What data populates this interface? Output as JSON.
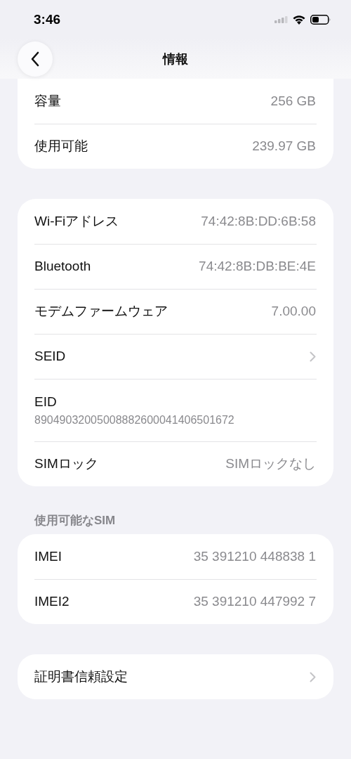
{
  "status_bar": {
    "time": "3:46"
  },
  "nav": {
    "title": "情報"
  },
  "groups": [
    {
      "continued": true,
      "rows": [
        {
          "kind": "value",
          "label": "容量",
          "value": "256 GB"
        },
        {
          "kind": "value",
          "label": "使用可能",
          "value": "239.97 GB"
        }
      ]
    },
    {
      "continued": false,
      "rows": [
        {
          "kind": "value",
          "label": "Wi-Fiアドレス",
          "value": "74:42:8B:DD:6B:58"
        },
        {
          "kind": "value",
          "label": "Bluetooth",
          "value": "74:42:8B:DB:BE:4E"
        },
        {
          "kind": "value",
          "label": "モデムファームウェア",
          "value": "7.00.00"
        },
        {
          "kind": "link",
          "label": "SEID"
        },
        {
          "kind": "stacked",
          "label": "EID",
          "value": "89049032005008882600041406501672"
        },
        {
          "kind": "value",
          "label": "SIMロック",
          "value": "SIMロックなし"
        }
      ]
    },
    {
      "continued": false,
      "header": "使用可能なSIM",
      "rows": [
        {
          "kind": "value",
          "label": "IMEI",
          "value": "35 391210 448838 1"
        },
        {
          "kind": "value",
          "label": "IMEI2",
          "value": "35 391210 447992 7"
        }
      ]
    },
    {
      "continued": false,
      "rows": [
        {
          "kind": "link",
          "label": "証明書信頼設定"
        }
      ]
    }
  ]
}
